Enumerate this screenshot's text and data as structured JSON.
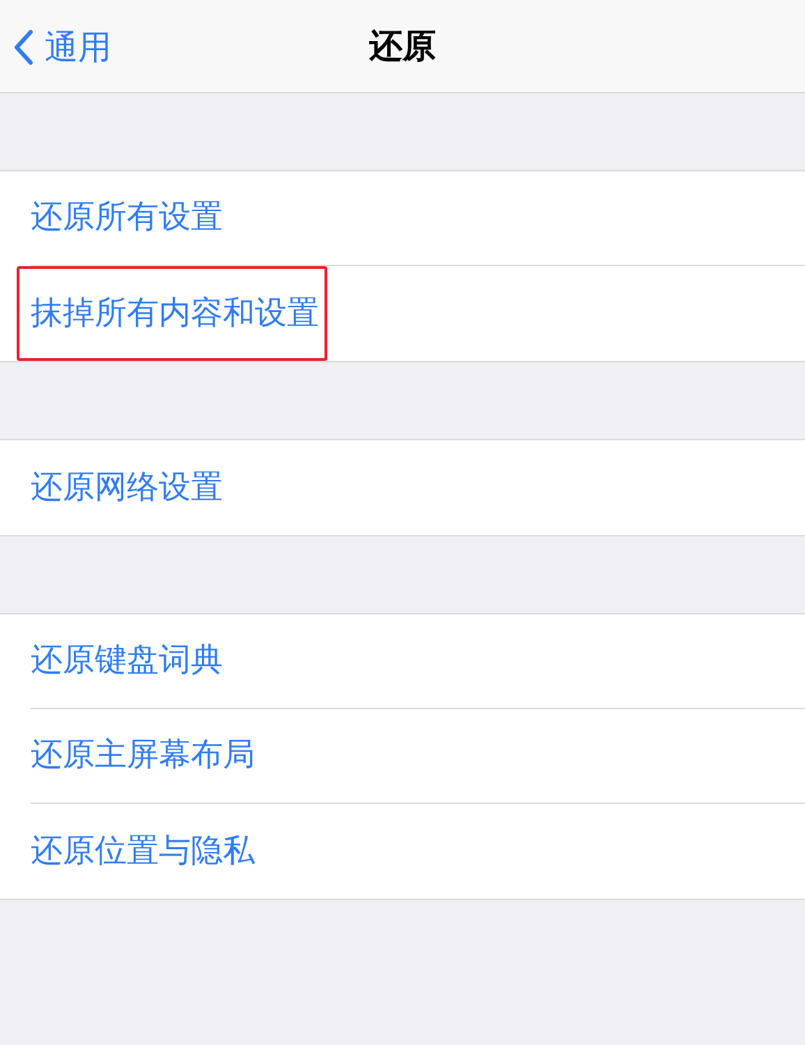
{
  "nav": {
    "back": "通用",
    "title": "还原"
  },
  "groups": [
    {
      "items": [
        {
          "label": "还原所有设置",
          "highlighted": false
        },
        {
          "label": "抹掉所有内容和设置",
          "highlighted": true
        }
      ]
    },
    {
      "items": [
        {
          "label": "还原网络设置",
          "highlighted": false
        }
      ]
    },
    {
      "items": [
        {
          "label": "还原键盘词典",
          "highlighted": false
        },
        {
          "label": "还原主屏幕布局",
          "highlighted": false
        },
        {
          "label": "还原位置与隐私",
          "highlighted": false
        }
      ]
    }
  ]
}
